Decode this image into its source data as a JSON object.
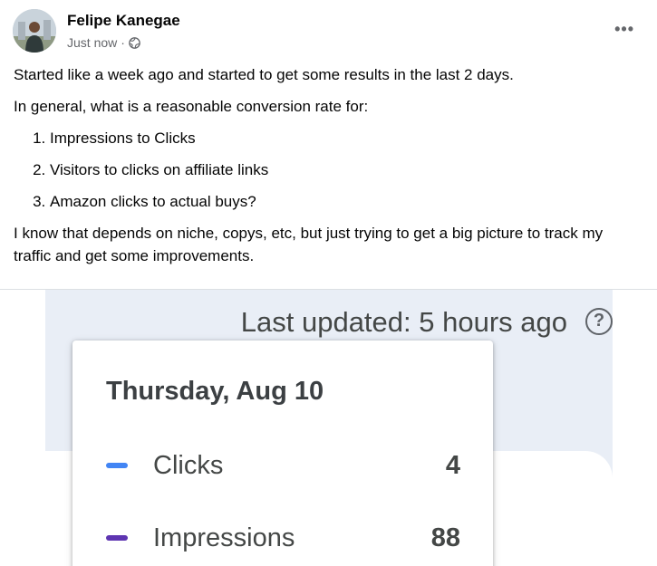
{
  "post": {
    "author": "Felipe Kanegae",
    "timestamp": "Just now",
    "separator": "·",
    "privacy_icon": "globe-icon",
    "more_icon": "more-options-icon",
    "more_label": "•••",
    "paragraphs": [
      "Started like a week ago and started to get some results in the last 2 days.",
      "In general, what is a reasonable conversion rate for:"
    ],
    "list": [
      "Impressions to Clicks",
      "Visitors to clicks on affiliate links",
      "Amazon clicks to actual buys?"
    ],
    "closing": "I know that depends on niche, copys, etc, but just trying to get a big picture to track my traffic and get some improvements."
  },
  "screenshot": {
    "last_updated": "Last updated: 5 hours ago",
    "help_label": "?",
    "tooltip": {
      "date": "Thursday, Aug 10",
      "rows": [
        {
          "label": "Clicks",
          "value": "4",
          "color": "#4285f4"
        },
        {
          "label": "Impressions",
          "value": "88",
          "color": "#5e35b1"
        }
      ]
    }
  }
}
